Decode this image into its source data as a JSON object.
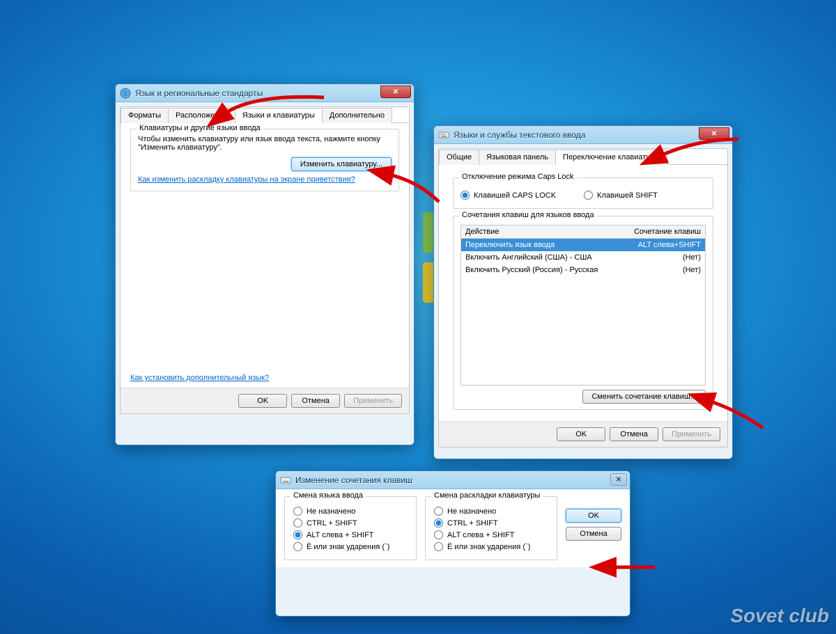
{
  "watermark": "Sovet club",
  "dialog1": {
    "title": "Язык и региональные стандарты",
    "tabs": [
      "Форматы",
      "Расположение",
      "Языки и клавиатуры",
      "Дополнительно"
    ],
    "activeTab": 2,
    "groupTitle": "Клавиатуры и другие языки ввода",
    "desc": "Чтобы изменить клавиатуру или язык ввода текста, нажмите кнопку \"Изменить клавиатуру\".",
    "changeBtn": "Изменить клавиатуру...",
    "helpLink": "Как изменить раскладку клавиатуры на экране приветствия?",
    "bottomLink": "Как установить дополнительный язык?",
    "ok": "OK",
    "cancel": "Отмена",
    "apply": "Применить"
  },
  "dialog2": {
    "title": "Языки и службы текстового ввода",
    "tabs": [
      "Общие",
      "Языковая панель",
      "Переключение клавиатуры"
    ],
    "activeTab": 2,
    "capsGroup": "Отключение режима Caps Lock",
    "capsOpt1": "Клавишей CAPS LOCK",
    "capsOpt2": "Клавишей SHIFT",
    "hotkeyGroup": "Сочетания клавиш для языков ввода",
    "colAction": "Действие",
    "colHotkey": "Сочетание клавиш",
    "rows": [
      {
        "action": "Переключить язык ввода",
        "hotkey": "ALT слева+SHIFT",
        "sel": true
      },
      {
        "action": "Включить Английский (США) - США",
        "hotkey": "(Нет)",
        "sel": false
      },
      {
        "action": "Включить Русский (Россия) - Русская",
        "hotkey": "(Нет)",
        "sel": false
      }
    ],
    "changeHotkey": "Сменить сочетание клавиш...",
    "ok": "OK",
    "cancel": "Отмена",
    "apply": "Применить"
  },
  "dialog3": {
    "title": "Изменение сочетания клавиш",
    "leftGroup": "Смена языка ввода",
    "rightGroup": "Смена раскладки клавиатуры",
    "opts": {
      "none": "Не назначено",
      "ctrlshift": "CTRL + SHIFT",
      "altshift": "ALT слева + SHIFT",
      "eaccent": "Ё или знак ударения (`)"
    },
    "leftSelected": 2,
    "rightSelected": 1,
    "ok": "OK",
    "cancel": "Отмена"
  }
}
